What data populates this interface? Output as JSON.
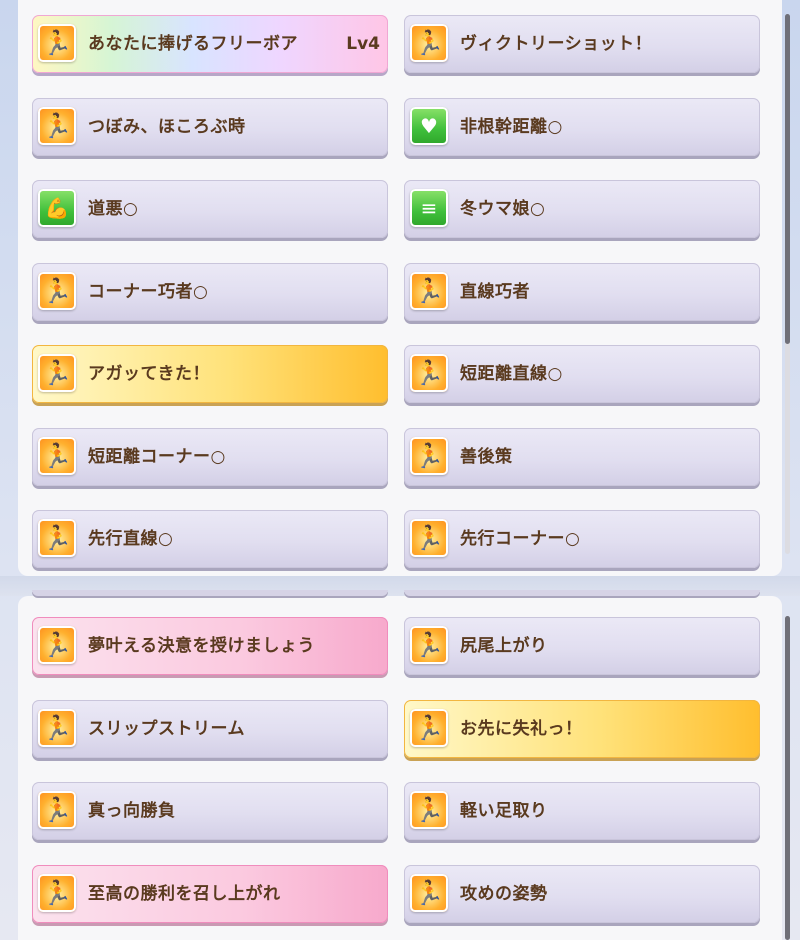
{
  "colors": {
    "text": "#5a3a1f",
    "normal_card": "#e1def0",
    "pink_card": "#fbc9df",
    "gold_card": "#ffe27a",
    "orange_icon": "#ffb02e",
    "green_icon": "#3fbf3b"
  },
  "top_list": [
    {
      "label": "あなたに捧げるフリーボア",
      "level": "Lv4",
      "style": "rainbow",
      "icon": "running-figure-icon"
    },
    {
      "label": "ヴィクトリーショット！",
      "style": "normal",
      "icon": "running-figure-icon"
    },
    {
      "label": "つぼみ、ほころぶ時",
      "style": "normal",
      "icon": "running-figure-icon"
    },
    {
      "label": "非根幹距離○",
      "style": "normal",
      "icon": "heart-icon"
    },
    {
      "label": "道悪○",
      "style": "normal",
      "icon": "muscle-arm-icon"
    },
    {
      "label": "冬ウマ娘○",
      "style": "normal",
      "icon": "speed-lines-icon"
    },
    {
      "label": "コーナー巧者○",
      "style": "normal",
      "icon": "running-figure-icon"
    },
    {
      "label": "直線巧者",
      "style": "normal",
      "icon": "running-figure-icon"
    },
    {
      "label": "アガッてきた！",
      "style": "gold",
      "icon": "running-figure-icon"
    },
    {
      "label": "短距離直線○",
      "style": "normal",
      "icon": "running-figure-icon"
    },
    {
      "label": "短距離コーナー○",
      "style": "normal",
      "icon": "running-figure-icon"
    },
    {
      "label": "善後策",
      "style": "normal",
      "icon": "running-figure-icon"
    },
    {
      "label": "先行直線○",
      "style": "normal",
      "icon": "running-figure-icon"
    },
    {
      "label": "先行コーナー○",
      "style": "normal",
      "icon": "running-figure-icon"
    }
  ],
  "bottom_list": [
    {
      "label": "夢叶える決意を授けましょう",
      "style": "pink",
      "icon": "running-figure-icon"
    },
    {
      "label": "尻尾上がり",
      "style": "normal",
      "icon": "running-figure-icon"
    },
    {
      "label": "スリップストリーム",
      "style": "normal",
      "icon": "running-figure-icon"
    },
    {
      "label": "お先に失礼っ！",
      "style": "gold",
      "icon": "running-figure-icon"
    },
    {
      "label": "真っ向勝負",
      "style": "normal",
      "icon": "running-figure-icon"
    },
    {
      "label": "軽い足取り",
      "style": "normal",
      "icon": "running-figure-icon"
    },
    {
      "label": "至高の勝利を召し上がれ",
      "style": "pink",
      "icon": "running-figure-icon"
    },
    {
      "label": "攻めの姿勢",
      "style": "normal",
      "icon": "running-figure-icon"
    }
  ]
}
